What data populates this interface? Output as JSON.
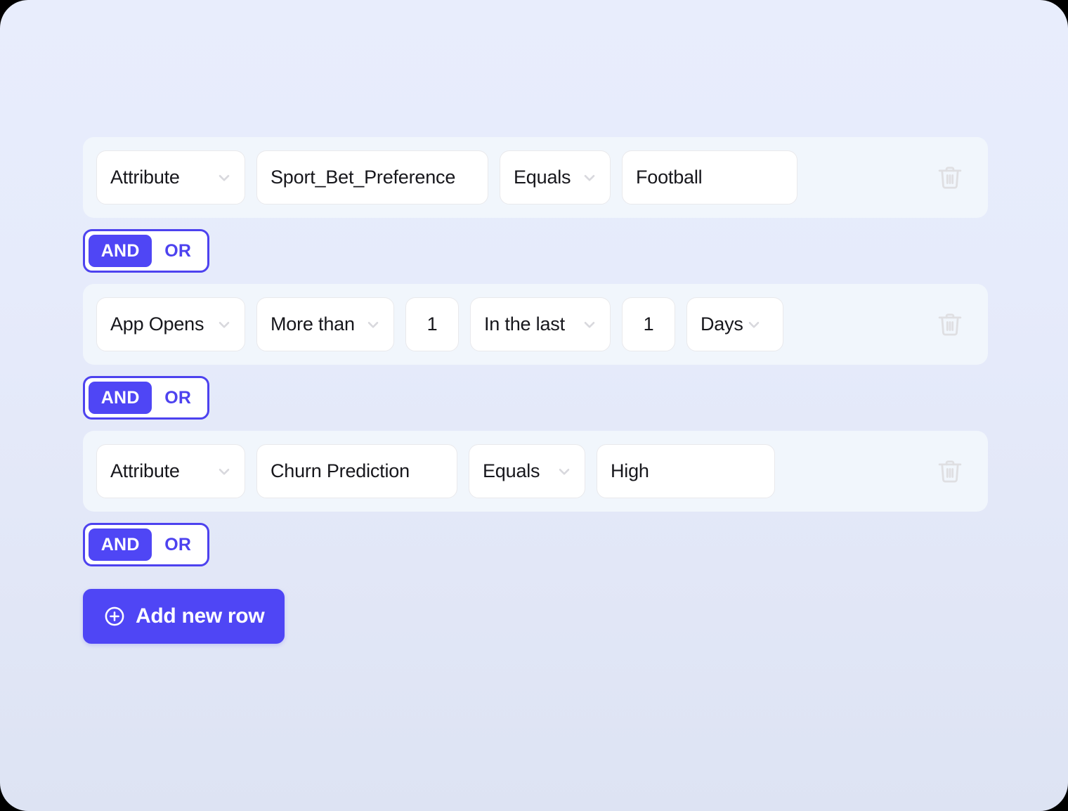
{
  "theme": {
    "accent": "#4f46f5",
    "accent_border": "#4d42ef",
    "row_bg": "#f1f6fc",
    "page_bg_top": "#e8edfc",
    "page_bg_bottom": "#dde3f3",
    "field_bg": "#ffffff",
    "field_border": "#e9e9ec",
    "text": "#17171c",
    "icon_muted": "#dfdfe2"
  },
  "builder": {
    "rows": [
      {
        "id": "row-1",
        "delete_icon": "trash-icon",
        "fields": [
          {
            "name": "row-1-source-select",
            "label": "Attribute",
            "type": "select",
            "chevron": "chevron-down-icon",
            "width_class": "w-attribute"
          },
          {
            "name": "row-1-attribute-select",
            "label": "Sport_Bet_Preference",
            "type": "text",
            "chevron": null,
            "width_class": "w-sportpref"
          },
          {
            "name": "row-1-operator-select",
            "label": "Equals",
            "type": "select",
            "chevron": "chevron-down-icon",
            "width_class": "w-equals"
          },
          {
            "name": "row-1-value-input",
            "label": "Football",
            "type": "text",
            "chevron": null,
            "width_class": "w-football"
          }
        ]
      },
      {
        "id": "row-2",
        "delete_icon": "trash-icon",
        "fields": [
          {
            "name": "row-2-source-select",
            "label": "App Opens",
            "type": "select",
            "chevron": "chevron-down-icon",
            "width_class": "w-appopens"
          },
          {
            "name": "row-2-operator-select",
            "label": "More than",
            "type": "select",
            "chevron": "chevron-down-icon",
            "width_class": "w-morethan"
          },
          {
            "name": "row-2-count-input",
            "label": "1",
            "type": "number",
            "chevron": null,
            "width_class": "w-num"
          },
          {
            "name": "row-2-timeframe-select",
            "label": "In the last",
            "type": "select",
            "chevron": "chevron-down-icon",
            "width_class": "w-inthelast"
          },
          {
            "name": "row-2-duration-input",
            "label": "1",
            "type": "number",
            "chevron": null,
            "width_class": "w-num"
          },
          {
            "name": "row-2-unit-select",
            "label": "Days",
            "type": "select-tight",
            "chevron": "chevron-down-icon",
            "width_class": "w-days"
          }
        ]
      },
      {
        "id": "row-3",
        "delete_icon": "trash-icon",
        "fields": [
          {
            "name": "row-3-source-select",
            "label": "Attribute",
            "type": "select",
            "chevron": "chevron-down-icon",
            "width_class": "w-attribute"
          },
          {
            "name": "row-3-attribute-select",
            "label": "Churn Prediction",
            "type": "text",
            "chevron": null,
            "width_class": "w-churn"
          },
          {
            "name": "row-3-operator-select",
            "label": "Equals",
            "type": "select",
            "chevron": "chevron-down-icon",
            "width_class": "w-equals3"
          },
          {
            "name": "row-3-value-input",
            "label": "High",
            "type": "text",
            "chevron": null,
            "width_class": "w-high"
          }
        ]
      }
    ],
    "logic_toggles": [
      {
        "name": "logic-toggle-1",
        "and_label": "AND",
        "or_label": "OR",
        "selected": "AND"
      },
      {
        "name": "logic-toggle-2",
        "and_label": "AND",
        "or_label": "OR",
        "selected": "AND"
      },
      {
        "name": "logic-toggle-3",
        "and_label": "AND",
        "or_label": "OR",
        "selected": "AND"
      }
    ],
    "add_row_button": {
      "label": "Add new row",
      "icon": "plus-circle-icon"
    }
  }
}
